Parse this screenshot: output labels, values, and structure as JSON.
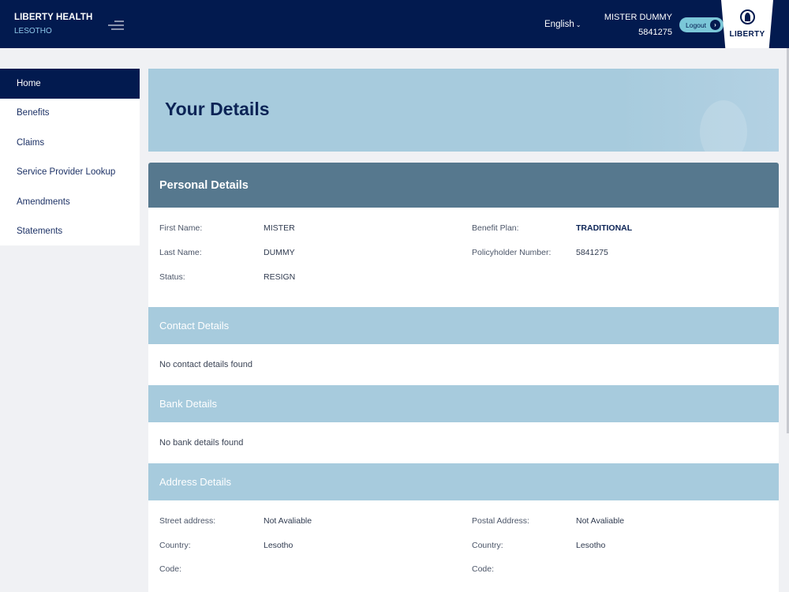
{
  "header": {
    "brand_title": "LIBERTY HEALTH",
    "brand_sub": "LESOTHO",
    "language": "English",
    "user_name": "MISTER DUMMY",
    "user_number": "5841275",
    "logout_label": "Logout",
    "logo_text": "LIBERTY"
  },
  "sidebar": {
    "items": [
      {
        "label": "Home"
      },
      {
        "label": "Benefits"
      },
      {
        "label": "Claims"
      },
      {
        "label": "Service Provider Lookup"
      },
      {
        "label": "Amendments"
      },
      {
        "label": "Statements"
      }
    ]
  },
  "page": {
    "title": "Your Details"
  },
  "personal": {
    "title": "Personal Details",
    "first_name_label": "First Name:",
    "first_name": "MISTER",
    "last_name_label": "Last Name:",
    "last_name": "DUMMY",
    "status_label": "Status:",
    "status": "RESIGN",
    "benefit_plan_label": "Benefit Plan:",
    "benefit_plan": "TRADITIONAL",
    "policyholder_label": "Policyholder Number:",
    "policyholder_number": "5841275"
  },
  "contact": {
    "title": "Contact Details",
    "empty": "No contact details found"
  },
  "bank": {
    "title": "Bank Details",
    "empty": "No bank details found"
  },
  "address": {
    "title": "Address Details",
    "street_label": "Street address:",
    "street_value": "Not Avaliable",
    "country_label": "Country:",
    "country_value": "Lesotho",
    "code_label": "Code:",
    "postal_label": "Postal Address:",
    "postal_value": "Not Avaliable",
    "postal_country_label": "Country:",
    "postal_country_value": "Lesotho",
    "postal_code_label": "Code:"
  },
  "colors": {
    "navy": "#021a4f",
    "section_blue": "#a7cbdd",
    "personal_header": "#56788e",
    "logout_bg": "#7bc7d8"
  }
}
